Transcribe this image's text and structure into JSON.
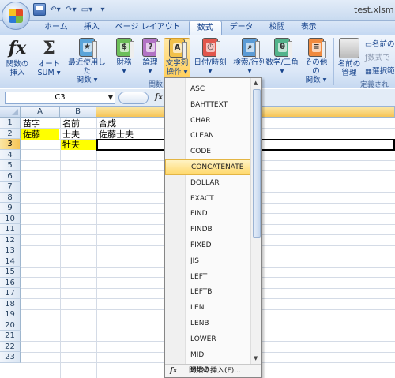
{
  "window": {
    "title": "test.xlsm"
  },
  "tabs": [
    "ホーム",
    "挿入",
    "ページ レイアウト",
    "数式",
    "データ",
    "校閲",
    "表示"
  ],
  "active_tab": "数式",
  "ribbon": {
    "insert_function": "関数の\n挿入",
    "autosum": "オート\nSUM ▾",
    "recent": "最近使用した\n関数 ▾",
    "financial": "財務\n▾",
    "logical": "論理\n▾",
    "text": "文字列\n操作 ▾",
    "datetime": "日付/時刻\n▾",
    "lookup": "検索/行列\n▾",
    "math": "数学/三角\n▾",
    "more": "その他の\n関数 ▾",
    "name_manager": "名前の\n管理",
    "group_label_library": "関数",
    "group_label_defined": "定義された",
    "name_define": "名前の",
    "use_in_formula": "数式で",
    "create_from_selection": "選択範"
  },
  "formula_bar": {
    "name_box": "C3",
    "fx": "fx"
  },
  "columns": [
    "A",
    "B",
    "C"
  ],
  "rows": [
    "1",
    "2",
    "3",
    "4",
    "5",
    "6",
    "7",
    "8",
    "9",
    "10",
    "11",
    "12",
    "13",
    "14",
    "15",
    "16",
    "17",
    "18",
    "19",
    "20",
    "21",
    "22",
    "23"
  ],
  "cells": {
    "A1": "苗字",
    "B1": "名前",
    "C1": "合成",
    "A2": "佐藤",
    "B2": "士夫",
    "C2": "佐藤士夫",
    "B3": "牡夫"
  },
  "dropdown": {
    "items": [
      "ASC",
      "BAHTTEXT",
      "CHAR",
      "CLEAN",
      "CODE",
      "CONCATENATE",
      "DOLLAR",
      "EXACT",
      "FIND",
      "FINDB",
      "FIXED",
      "JIS",
      "LEFT",
      "LEFTB",
      "LEN",
      "LENB",
      "LOWER",
      "MID",
      "MIDB"
    ],
    "highlighted": "CONCATENATE",
    "footer": "関数の挿入(F)..."
  },
  "colors": {
    "yellow_fill": "#ffff00",
    "ribbon_blue": "#15428b",
    "highlight": "#ffd86b"
  }
}
